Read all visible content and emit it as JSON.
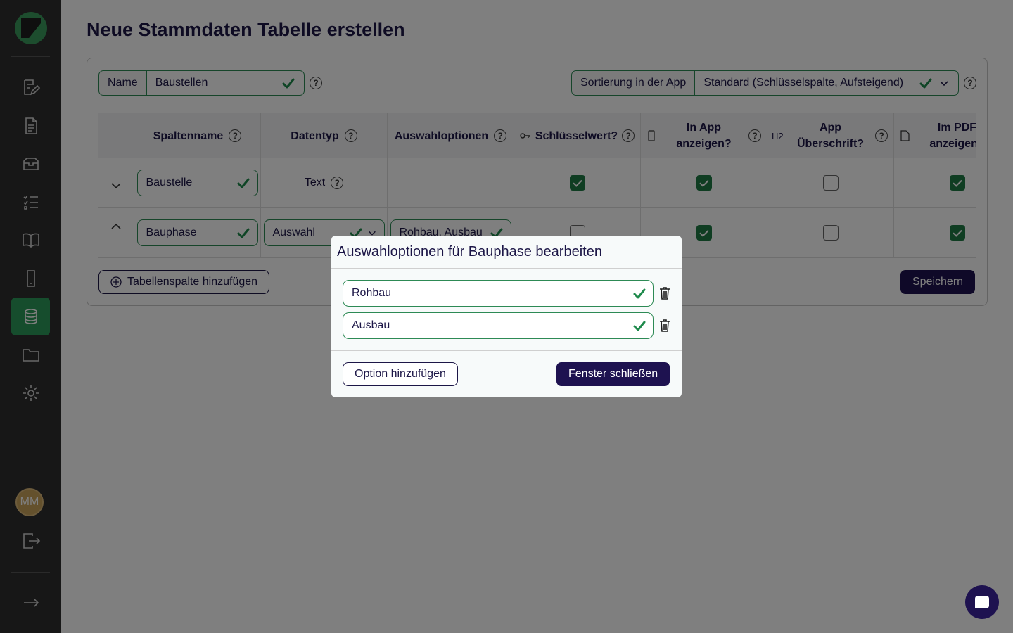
{
  "sidebar": {
    "avatar_initials": "MM",
    "items": [
      {
        "icon": "edit-document-icon"
      },
      {
        "icon": "document-icon"
      },
      {
        "icon": "inbox-icon"
      },
      {
        "icon": "checklist-icon"
      },
      {
        "icon": "book-icon"
      },
      {
        "icon": "mobile-icon"
      },
      {
        "icon": "database-icon",
        "active": true
      },
      {
        "icon": "folder-icon"
      },
      {
        "icon": "gear-icon"
      }
    ]
  },
  "page": {
    "title": "Neue Stammdaten Tabelle erstellen",
    "name_label": "Name",
    "name_value": "Baustellen",
    "sort_label": "Sortierung in der App",
    "sort_value": "Standard (Schlüsselspalte, Aufsteigend)"
  },
  "table": {
    "headers": {
      "spaltenname": "Spaltenname",
      "datentyp": "Datentyp",
      "auswahloptionen": "Auswahloptionen",
      "schluesselwert": "Schlüsselwert?",
      "in_app_1": "In App",
      "in_app_2": "anzeigen?",
      "h2": "H2",
      "ueberschrift_1": "App",
      "ueberschrift_2": "Überschrift?",
      "pdf_1": "Im PDF",
      "pdf_2": "anzeigen?"
    },
    "rows": [
      {
        "name": "Baustelle",
        "type": "Text",
        "options": "",
        "key": true,
        "in_app": true,
        "ueberschrift": false,
        "pdf": true
      },
      {
        "name": "Bauphase",
        "type": "Auswahl",
        "options": "Rohbau, Ausbau",
        "key": false,
        "in_app": true,
        "ueberschrift": false,
        "pdf": true
      }
    ],
    "add_column_label": "Tabellenspalte hinzufügen",
    "save_label": "Speichern"
  },
  "modal": {
    "title": "Auswahloptionen für Bauphase bearbeiten",
    "options": [
      "Rohbau",
      "Ausbau"
    ],
    "add_option_label": "Option hinzufügen",
    "close_label": "Fenster schließen"
  },
  "colors": {
    "sidebar": "#2e2e2e",
    "accent_green": "#2d9a5a",
    "primary": "#1e1250"
  }
}
